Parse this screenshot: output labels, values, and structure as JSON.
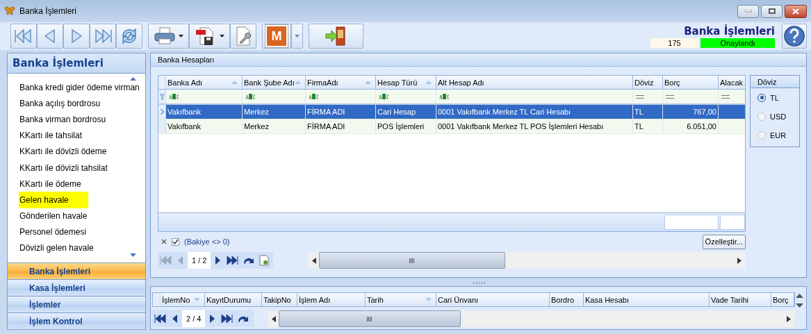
{
  "window": {
    "title": "Banka İşlemleri"
  },
  "toolbar": {
    "m_button": {
      "label": "M"
    }
  },
  "header": {
    "title": "Banka İşlemleri",
    "record_no": "175",
    "status": "Onaylandı"
  },
  "sidebar": {
    "title": "Banka İşlemleri",
    "items": [
      {
        "label": "Banka kredi gider ödeme virman",
        "selected": false
      },
      {
        "label": "Banka açılış bordrosu",
        "selected": false
      },
      {
        "label": "Banka virman bordrosu",
        "selected": false
      },
      {
        "label": "KKartı ile tahsilat",
        "selected": false
      },
      {
        "label": "KKartı ile dövizli ödeme",
        "selected": false
      },
      {
        "label": "KKartı ile dövizli tahsilat",
        "selected": false
      },
      {
        "label": "KKartı ile ödeme",
        "selected": false
      },
      {
        "label": "Gelen havale",
        "selected": true
      },
      {
        "label": "Gönderilen havale",
        "selected": false
      },
      {
        "label": "Personel ödemesi",
        "selected": false
      },
      {
        "label": "Dövizli gelen havale",
        "selected": false
      }
    ],
    "groups": [
      {
        "label": "Banka İşlemleri",
        "selected": true
      },
      {
        "label": "Kasa İşlemleri",
        "selected": false
      },
      {
        "label": "İşlemler",
        "selected": false
      },
      {
        "label": "İşlem Kontrol",
        "selected": false
      }
    ]
  },
  "accounts": {
    "title": "Banka Hesapları",
    "columns": [
      {
        "label": "Banka Adı",
        "sorted": true,
        "kind": "text"
      },
      {
        "label": "Bank Şube Adı",
        "sorted": true,
        "kind": "text"
      },
      {
        "label": "FirmaAdı",
        "sorted": true,
        "kind": "text"
      },
      {
        "label": "Hesap Türü",
        "sorted": true,
        "kind": "text"
      },
      {
        "label": "Alt Hesap Adı",
        "sorted": false,
        "kind": "text"
      },
      {
        "label": "Döviz",
        "sorted": false,
        "kind": "number"
      },
      {
        "label": "Borç",
        "sorted": false,
        "kind": "number"
      },
      {
        "label": "Alacak",
        "sorted": false,
        "kind": "number"
      }
    ],
    "rows": [
      {
        "selected": true,
        "cells": [
          "Vakıfbank",
          "Merkez",
          "FİRMA ADI",
          "Cari Hesap",
          "0001 Vakıfbank Merkez TL Cari Hesabı",
          "TL",
          "767,00",
          ""
        ]
      },
      {
        "selected": false,
        "cells": [
          "Vakıfbank",
          "Merkez",
          "FİRMA ADI",
          "POS İşlemleri",
          "0001 Vakıfbank Merkez TL POS İşlemleri Hesabı",
          "TL",
          "6.051,00",
          ""
        ]
      }
    ],
    "filter": {
      "checked": true,
      "text": "(Bakiye <> 0)"
    },
    "customize_button": "Özelleştir...",
    "pager": "1 / 2"
  },
  "currency": {
    "title": "Döviz",
    "options": [
      {
        "label": "TL",
        "selected": true
      },
      {
        "label": "USD",
        "selected": false
      },
      {
        "label": "EUR",
        "selected": false
      }
    ]
  },
  "transactions": {
    "columns": [
      {
        "label": "İşlemNo",
        "sorted": true
      },
      {
        "label": "KayıtDurumu",
        "sorted": false
      },
      {
        "label": "TakipNo",
        "sorted": false
      },
      {
        "label": "İşlem Adı",
        "sorted": false
      },
      {
        "label": "Tarih",
        "sorted": true
      },
      {
        "label": "Cari Ünvanı",
        "sorted": false
      },
      {
        "label": "Bordro",
        "sorted": false
      },
      {
        "label": "Kasa Hesabı",
        "sorted": false
      },
      {
        "label": "Vade Tarihi",
        "sorted": false
      },
      {
        "label": "Borç",
        "sorted": false
      }
    ],
    "pager": "2 / 4"
  }
}
